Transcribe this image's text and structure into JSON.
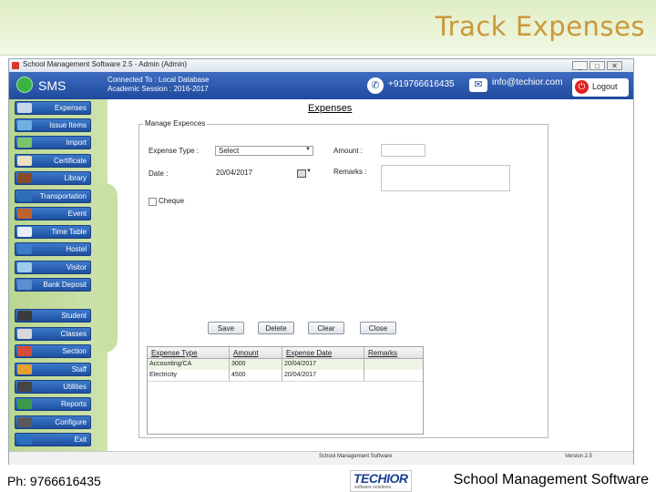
{
  "slide": {
    "title": "Track Expenses",
    "footer_phone": "Ph: 9766616435",
    "footer_app": "School Management Software",
    "logo_text": "TECHIOR",
    "logo_sub": "software solutions"
  },
  "window": {
    "title": "School Management Software 2.5 - Admin (Admin)",
    "controls": [
      "_",
      "□",
      "✕"
    ]
  },
  "header": {
    "app_name": "SMS",
    "connected": "Connected To : Local Database",
    "session": "Academic Session : 2016-2017",
    "phone": "+919766616435",
    "email": "info@techior.com",
    "logout": "Logout"
  },
  "sidebar": {
    "items": [
      {
        "label": "Expenses",
        "icon": "wallet-icon",
        "color": "#c9d6e8"
      },
      {
        "label": "Issue Items",
        "icon": "box-icon",
        "color": "#6fb0e0"
      },
      {
        "label": "Import",
        "icon": "import-icon",
        "color": "#7cc46a"
      },
      {
        "label": "Certificate",
        "icon": "certificate-icon",
        "color": "#e8e0c0"
      },
      {
        "label": "Library",
        "icon": "books-icon",
        "color": "#8a4b2a"
      },
      {
        "label": "Transportation",
        "icon": "bus-icon",
        "color": "#2f6db8"
      },
      {
        "label": "Event",
        "icon": "event-icon",
        "color": "#c0622e"
      },
      {
        "label": "Time Table",
        "icon": "clock-icon",
        "color": "#e8eef5"
      },
      {
        "label": "Hostel",
        "icon": "building-icon",
        "color": "#3a7dc8"
      },
      {
        "label": "Visitor",
        "icon": "visitor-icon",
        "color": "#9ecbe8"
      },
      {
        "label": "Bank Deposit",
        "icon": "bank-icon",
        "color": "#5b8fd0"
      },
      {
        "label": "Student",
        "icon": "student-icon",
        "color": "#3b3b3b"
      },
      {
        "label": "Classes",
        "icon": "classroom-icon",
        "color": "#d8d8d8"
      },
      {
        "label": "Section",
        "icon": "section-icon",
        "color": "#d84a3a"
      },
      {
        "label": "Staff",
        "icon": "staff-icon",
        "color": "#e8a030"
      },
      {
        "label": "Utilities",
        "icon": "tools-icon",
        "color": "#444444"
      },
      {
        "label": "Reports",
        "icon": "reports-icon",
        "color": "#3a9a4a"
      },
      {
        "label": "Configure",
        "icon": "gear-icon",
        "color": "#5a5a5a"
      },
      {
        "label": "Exit",
        "icon": "exit-icon",
        "color": "#2a6fc0"
      }
    ]
  },
  "form": {
    "title": "Expenses",
    "legend": "Manage Expences",
    "expense_type_label": "Expense Type :",
    "expense_type_value": "Select",
    "amount_label": "Amount :",
    "date_label": "Date :",
    "date_value": "20/04/2017",
    "remarks_label": "Remarks :",
    "cheque_label": "Cheque"
  },
  "actions": {
    "save": "Save",
    "delete": "Delete",
    "clear": "Clear",
    "close": "Close"
  },
  "table": {
    "columns": [
      "Expense Type",
      "Amount",
      "Expense Date",
      "Remarks"
    ],
    "rows": [
      [
        "Accounting/CA",
        "3000",
        "20/04/2017",
        ""
      ],
      [
        "Electricity",
        "4500",
        "20/04/2017",
        ""
      ]
    ]
  },
  "status": {
    "app": "School Management Software",
    "version": "Version 2.5"
  },
  "colors": {
    "accent_blue": "#1f4a9e",
    "sidebar_green": "#b9d68f",
    "title_gold": "#c79a3a"
  }
}
